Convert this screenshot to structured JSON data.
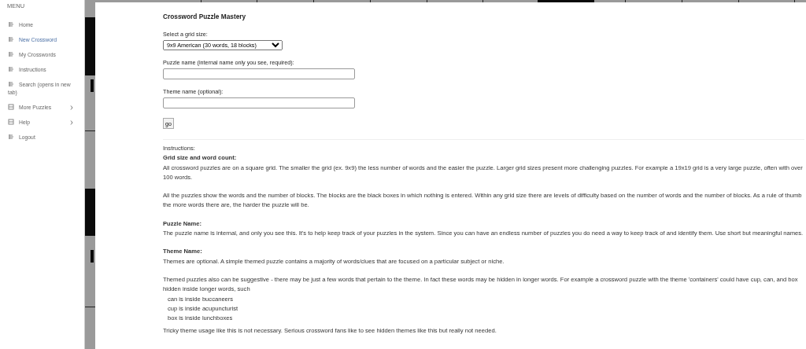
{
  "sidebar": {
    "header": "MENU",
    "items": [
      {
        "label": "Home",
        "selected": false,
        "submenu": false
      },
      {
        "label": "New Crossword",
        "selected": true,
        "submenu": false
      },
      {
        "label": "My Crosswords",
        "selected": false,
        "submenu": false
      },
      {
        "label": "Instructions",
        "selected": false,
        "submenu": false
      },
      {
        "label": "Search (opens in new tab)",
        "selected": false,
        "submenu": false
      },
      {
        "label": "More Puzzles",
        "selected": false,
        "submenu": true
      },
      {
        "label": "Help",
        "selected": false,
        "submenu": true
      },
      {
        "label": "Logout",
        "selected": false,
        "submenu": false
      }
    ]
  },
  "form": {
    "title": "Crossword Puzzle Mastery",
    "fields": [
      {
        "kind": "select",
        "label": "Select a grid size:",
        "value": "9x9  American  (30 words, 18 blocks)"
      },
      {
        "kind": "text",
        "label": "Puzzle name (internal name only you see, required):"
      },
      {
        "kind": "text",
        "label": "Theme name (optional):"
      }
    ],
    "button": "go"
  },
  "instructions": [
    {
      "kind": "line",
      "text": "Instructions:"
    },
    {
      "kind": "heading",
      "text": "Grid size and word count:"
    },
    {
      "kind": "paragraph",
      "text": "All crossword puzzles are on a square grid. The smaller the grid (ex. 9x9) the less number of words and the easier the puzzle. Larger grid sizes present more challenging puzzles. For example a 19x19 grid is a very large puzzle, often with over 100 words."
    },
    {
      "kind": "paragraph",
      "text": "All the puzzles show the words and the number of blocks. The blocks are the black boxes in which nothing is entered. Within any grid size there are levels of difficulty based on the number of words and the number of blocks. As a rule of thumb the more words there are, the harder the puzzle will be."
    },
    {
      "kind": "heading",
      "text": "Puzzle Name:"
    },
    {
      "kind": "paragraph",
      "text": "The puzzle name is internal, and only you see this. It's to help keep track of your puzzles in the system. Since you can have an endless number of puzzles you do need a way to keep track of and identify them. Use short but meaningful names."
    },
    {
      "kind": "heading",
      "text": "Theme Name:"
    },
    {
      "kind": "paragraph",
      "text": "Themes are optional. A simple themed puzzle contains a majority of words/clues that are focused on a particular subject or niche."
    },
    {
      "kind": "line",
      "text": "Themed puzzles also can be suggestive - there may be just a few words that pertain to the theme. In fact these words may be hidden in longer words. For example a crossword puzzle with the theme 'containers' could have cup, can, and box hidden inside longer words, such"
    },
    {
      "kind": "example",
      "text": "can is inside buccaneers"
    },
    {
      "kind": "example",
      "text": "cup is inside acupuncturist"
    },
    {
      "kind": "example",
      "text": "box is inside lunchboxes"
    },
    {
      "kind": "spacer"
    },
    {
      "kind": "line",
      "text": "Tricky theme usage like this is not necessary. Serious crossword fans like to see hidden themes like this but really not needed."
    }
  ]
}
